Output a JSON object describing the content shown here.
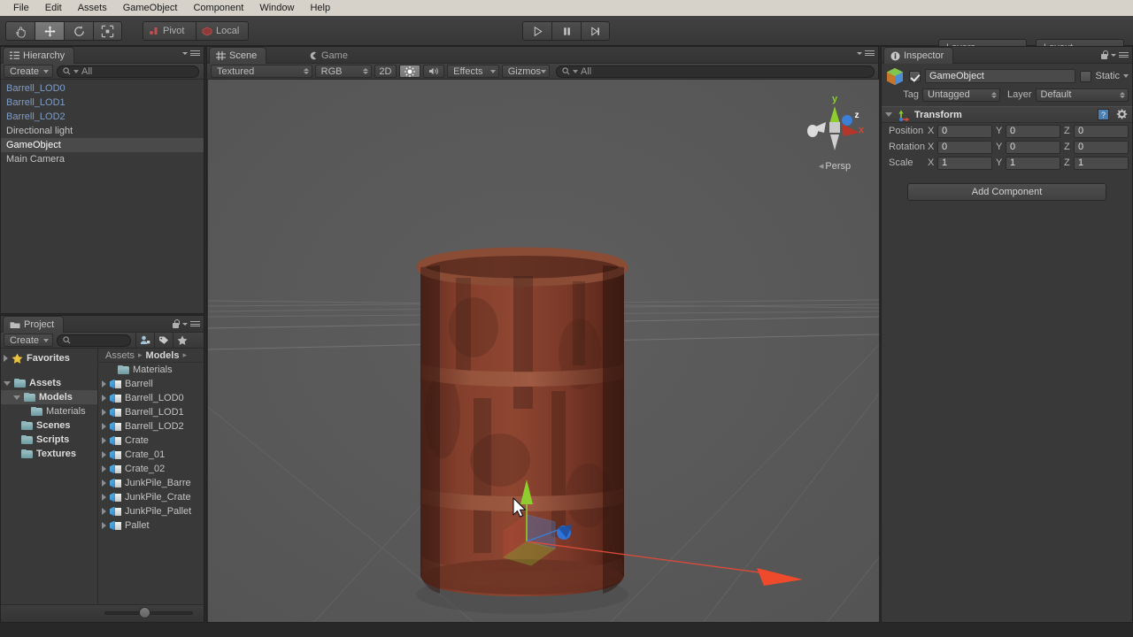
{
  "menubar": {
    "items": [
      "File",
      "Edit",
      "Assets",
      "GameObject",
      "Component",
      "Window",
      "Help"
    ]
  },
  "toolbar": {
    "tools": [
      {
        "name": "hand-tool",
        "icon": "hand-icon",
        "active": false
      },
      {
        "name": "move-tool",
        "icon": "move-icon",
        "active": true
      },
      {
        "name": "rotate-tool",
        "icon": "rotate-icon",
        "active": false
      },
      {
        "name": "scale-tool",
        "icon": "scale-icon",
        "active": false
      }
    ],
    "pivot_label": "Pivot",
    "space_label": "Local",
    "play_label": "play-icon",
    "pause_label": "pause-icon",
    "step_label": "step-icon",
    "layers_label": "Layers",
    "layout_label": "Layout"
  },
  "hierarchy": {
    "tab_label": "Hierarchy",
    "create_label": "Create",
    "search_placeholder": "All",
    "items": [
      {
        "label": "Barrell_LOD0",
        "prefab": true,
        "selected": false
      },
      {
        "label": "Barrell_LOD1",
        "prefab": true,
        "selected": false
      },
      {
        "label": "Barrell_LOD2",
        "prefab": true,
        "selected": false
      },
      {
        "label": "Directional light",
        "prefab": false,
        "selected": false
      },
      {
        "label": "GameObject",
        "prefab": false,
        "selected": true
      },
      {
        "label": "Main Camera",
        "prefab": false,
        "selected": false
      }
    ]
  },
  "project": {
    "tab_label": "Project",
    "create_label": "Create",
    "search_placeholder": "",
    "favorites_label": "Favorites",
    "tree": [
      {
        "label": "Assets",
        "indent": 0,
        "open": true,
        "selected": false
      },
      {
        "label": "Models",
        "indent": 1,
        "open": true,
        "selected": true
      },
      {
        "label": "Materials",
        "indent": 2,
        "open": false,
        "selected": false,
        "leaf": true
      },
      {
        "label": "Scenes",
        "indent": 1,
        "open": false,
        "selected": false,
        "leaf": true
      },
      {
        "label": "Scripts",
        "indent": 1,
        "open": false,
        "selected": false,
        "leaf": true
      },
      {
        "label": "Textures",
        "indent": 1,
        "open": false,
        "selected": false,
        "leaf": true
      }
    ],
    "breadcrumb": [
      "Assets",
      "Models"
    ],
    "assets": [
      {
        "label": "Materials",
        "type": "folder"
      },
      {
        "label": "Barrell",
        "type": "prefab"
      },
      {
        "label": "Barrell_LOD0",
        "type": "prefab"
      },
      {
        "label": "Barrell_LOD1",
        "type": "prefab"
      },
      {
        "label": "Barrell_LOD2",
        "type": "prefab"
      },
      {
        "label": "Crate",
        "type": "prefab"
      },
      {
        "label": "Crate_01",
        "type": "prefab"
      },
      {
        "label": "Crate_02",
        "type": "prefab"
      },
      {
        "label": "JunkPile_Barre",
        "type": "prefab"
      },
      {
        "label": "JunkPile_Crate",
        "type": "prefab"
      },
      {
        "label": "JunkPile_Pallet",
        "type": "prefab"
      },
      {
        "label": "Pallet",
        "type": "prefab"
      }
    ]
  },
  "scene": {
    "tab_scene": "Scene",
    "tab_game": "Game",
    "draw_mode": "Textured",
    "color_mode": "RGB",
    "mode_2d": "2D",
    "lighting": "sun-icon",
    "audio": "audio-icon",
    "effects": "Effects",
    "gizmos": "Gizmos",
    "search_placeholder": "All",
    "axis_x": "x",
    "axis_y": "y",
    "axis_z": "z",
    "projection": "Persp"
  },
  "inspector": {
    "tab_label": "Inspector",
    "object_name": "GameObject",
    "enabled": true,
    "static_label": "Static",
    "tag_label": "Tag",
    "tag_value": "Untagged",
    "layer_label": "Layer",
    "layer_value": "Default",
    "component_title": "Transform",
    "rows": [
      {
        "label": "Position",
        "x": "0",
        "y": "0",
        "z": "0"
      },
      {
        "label": "Rotation",
        "x": "0",
        "y": "0",
        "z": "0"
      },
      {
        "label": "Scale",
        "x": "1",
        "y": "1",
        "z": "1"
      }
    ],
    "axis_labels": [
      "X",
      "Y",
      "Z"
    ],
    "add_component_label": "Add Component"
  },
  "colors": {
    "menubar_bg": "#d6d2ca",
    "panel_bg": "#393939",
    "scene_bg": "#595959",
    "prefab_text": "#7d9ec9",
    "selection_bg": "#4a4a4a",
    "axis_x": "#d64b3b",
    "axis_y": "#8ecc30",
    "axis_z": "#3b7fd6",
    "barrel_rust": "#7a3a28"
  }
}
